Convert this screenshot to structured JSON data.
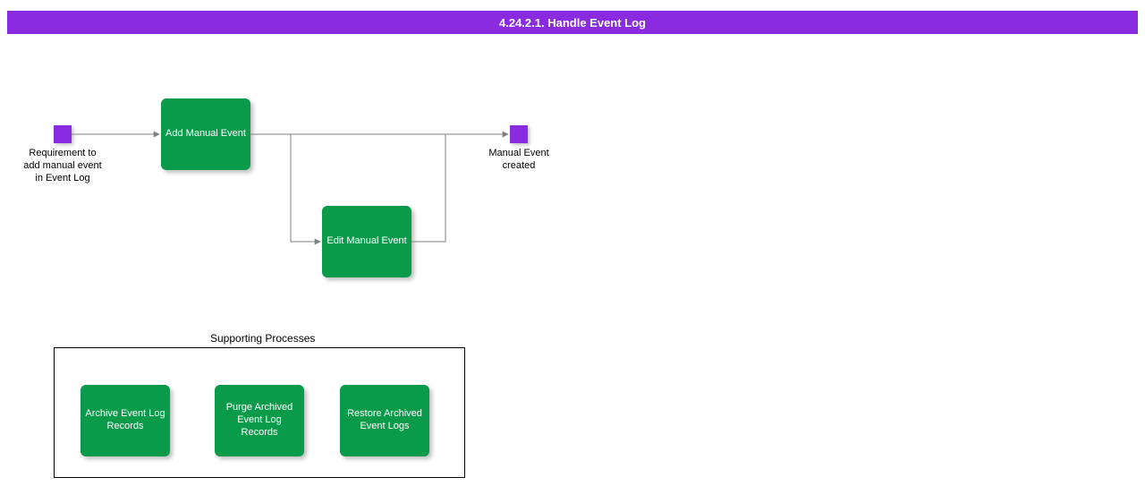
{
  "header": {
    "title": "4.24.2.1. Handle Event Log"
  },
  "colors": {
    "accent": "#8a2be2",
    "process": "#0a9b4a"
  },
  "events": {
    "start": {
      "label": "Requirement to add manual event in Event Log"
    },
    "end": {
      "label": "Manual Event created"
    }
  },
  "processes": {
    "add": {
      "label": "Add Manual Event"
    },
    "edit": {
      "label": "Edit Manual Event"
    }
  },
  "supporting": {
    "title": "Supporting Processes",
    "items": [
      {
        "label": "Archive Event Log Records"
      },
      {
        "label": "Purge Archived Event Log Records"
      },
      {
        "label": "Restore Archived Event Logs"
      }
    ]
  }
}
